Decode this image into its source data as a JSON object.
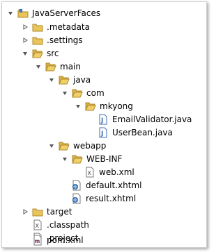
{
  "tree": {
    "project": "JavaServerFaces",
    "metadata": ".metadata",
    "settings": ".settings",
    "src": "src",
    "main": "main",
    "java": "java",
    "com": "com",
    "mkyong": "mkyong",
    "email_validator": "EmailValidator.java",
    "user_bean": "UserBean.java",
    "webapp": "webapp",
    "web_inf": "WEB-INF",
    "web_xml": "web.xml",
    "default_xhtml": "default.xhtml",
    "result_xhtml": "result.xhtml",
    "target": "target",
    "classpath": ".classpath",
    "project_file": ".project",
    "pom": "pom.xml"
  },
  "icons": {
    "expanded": "triangle-down-icon",
    "collapsed": "triangle-right-icon",
    "folder": "folder-icon",
    "open-folder": "open-folder-icon",
    "project": "java-project-icon",
    "java-file": "java-file-icon",
    "xml-file": "xml-file-icon",
    "web-file": "xhtml-file-icon",
    "maven-file": "maven-pom-icon"
  },
  "colors": {
    "folder": "#e8c45a",
    "folder_edge": "#b08a2a",
    "java_file": "#3b6fb6",
    "triangle": "#555555"
  }
}
